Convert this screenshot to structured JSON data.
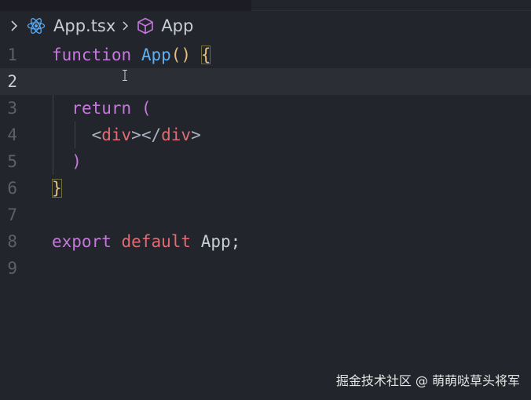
{
  "breadcrumb": {
    "file": "App.tsx",
    "symbol": "App"
  },
  "editor": {
    "lines": [
      {
        "number": "1"
      },
      {
        "number": "2"
      },
      {
        "number": "3"
      },
      {
        "number": "4"
      },
      {
        "number": "5"
      },
      {
        "number": "6"
      },
      {
        "number": "7"
      },
      {
        "number": "8"
      },
      {
        "number": "9"
      }
    ],
    "current_line": "2",
    "tokens": {
      "l1_kw": "function",
      "l1_name": "App",
      "l1_parens": "()",
      "l1_brace": "{",
      "l3_kw": "return",
      "l3_paren": "(",
      "l4_open_lt": "<",
      "l4_open_tag": "div",
      "l4_open_gt": ">",
      "l4_close_lt": "</",
      "l4_close_tag": "div",
      "l4_close_gt": ">",
      "l5_paren": ")",
      "l6_brace": "}",
      "l8_export": "export",
      "l8_default": "default",
      "l8_name": "App",
      "l8_semi": ";"
    }
  },
  "watermark": "掘金技术社区 @ 萌萌哒草头将军",
  "colors": {
    "background": "#22252b",
    "keyword": "#c678dd",
    "function": "#61afef",
    "brace": "#e5c07b",
    "tag": "#e06c75"
  },
  "icons": [
    "chevron-right-icon",
    "react-icon",
    "cube-icon",
    "text-cursor-icon"
  ]
}
